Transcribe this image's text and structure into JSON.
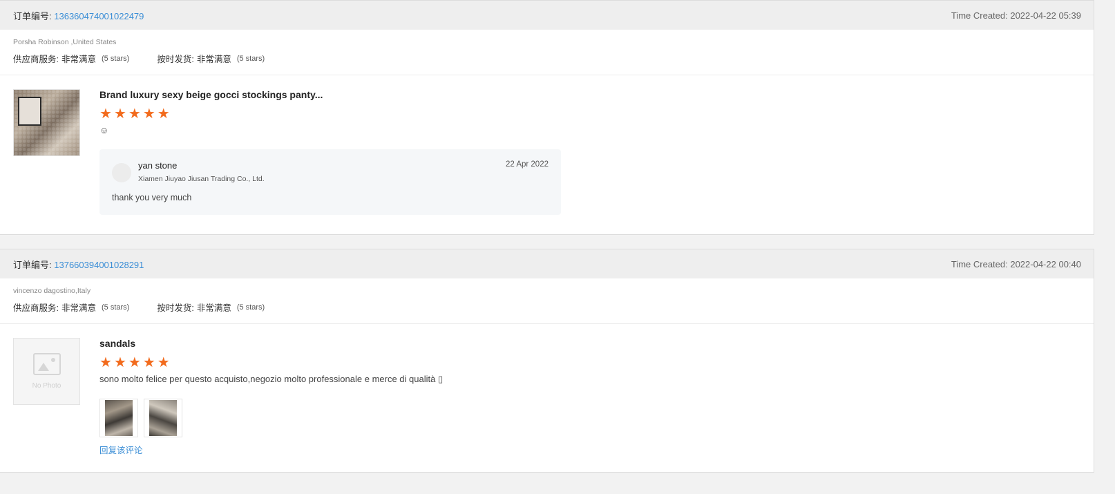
{
  "orders": [
    {
      "order_label": "订单编号:",
      "order_no": "136360474001022479",
      "time_created": "Time Created: 2022-04-22 05:39",
      "buyer": "Porsha Robinson ,United States",
      "supplier_service_label": "供应商服务:",
      "supplier_service_value": "非常满意",
      "supplier_service_stars": "(5 stars)",
      "ontime_label": "按时发货:",
      "ontime_value": "非常满意",
      "ontime_stars": "(5 stars)",
      "product_title": "Brand luxury sexy beige gocci stockings panty...",
      "rating": 5,
      "review_text": "☺",
      "reply": {
        "name": "yan stone",
        "company": "Xiamen Jiuyao Jiusan Trading Co., Ltd.",
        "date": "22 Apr 2022",
        "text": "thank you very much"
      }
    },
    {
      "order_label": "订单编号:",
      "order_no": "137660394001028291",
      "time_created": "Time Created: 2022-04-22 00:40",
      "buyer": "vincenzo dagostino,Italy",
      "supplier_service_label": "供应商服务:",
      "supplier_service_value": "非常满意",
      "supplier_service_stars": "(5 stars)",
      "ontime_label": "按时发货:",
      "ontime_value": "非常满意",
      "ontime_stars": "(5 stars)",
      "product_title": "sandals",
      "rating": 5,
      "no_photo_text": "No Photo",
      "review_text": "sono molto felice per questo acquisto,negozio molto professionale e merce di qualità ▯",
      "reply_link": "回复该评论"
    }
  ],
  "colors": {
    "accent_link": "#3b8ed6",
    "star": "#f26b1d",
    "header_bg": "#eeeeee"
  }
}
